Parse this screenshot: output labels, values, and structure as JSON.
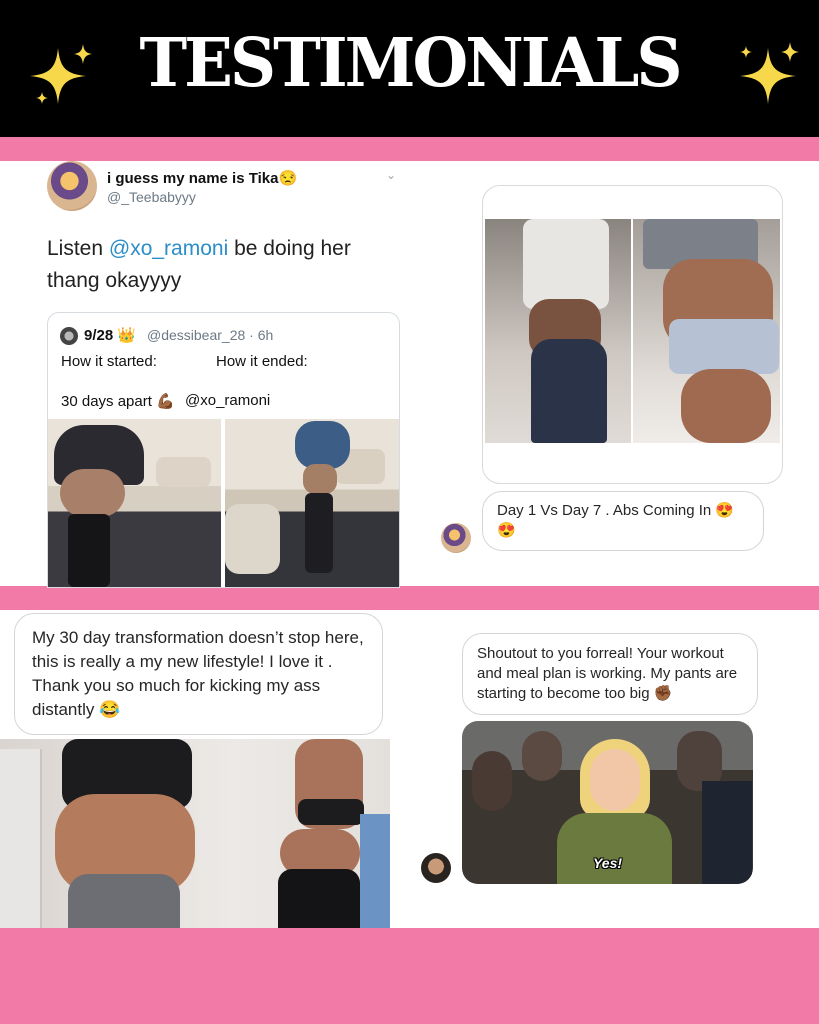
{
  "header": {
    "title": "TESTIMONIALS",
    "accent_color": "#f27aa6",
    "sparkle_color": "#f7d84a"
  },
  "tweet": {
    "display_name": "i guess my name is Tika😒",
    "handle": "@_Teebabyyy",
    "text_before": "Listen ",
    "mention": "@xo_ramoni",
    "text_after": " be doing her thang okayyyy",
    "quoted": {
      "header": "9/28 👑",
      "handle_time": "@dessibear_28 · 6h",
      "label_started": "How it started:",
      "label_ended": "How it ended:",
      "apart": "30 days apart 💪🏾",
      "mention": "@xo_ramoni"
    }
  },
  "dm_top": {
    "message": "Day 1 Vs Day 7 . Abs Coming In 😍😍"
  },
  "dm_bottom_left": {
    "message": "My 30 day transformation doesn’t stop here, this is really a my new lifestyle! I love it . Thank you so much for kicking my ass distantly 😂"
  },
  "dm_bottom_right": {
    "message": "Shoutout to you forreal! Your workout and meal plan is working. My pants are starting to become too big ✊🏾",
    "gif_caption": "Yes!"
  }
}
